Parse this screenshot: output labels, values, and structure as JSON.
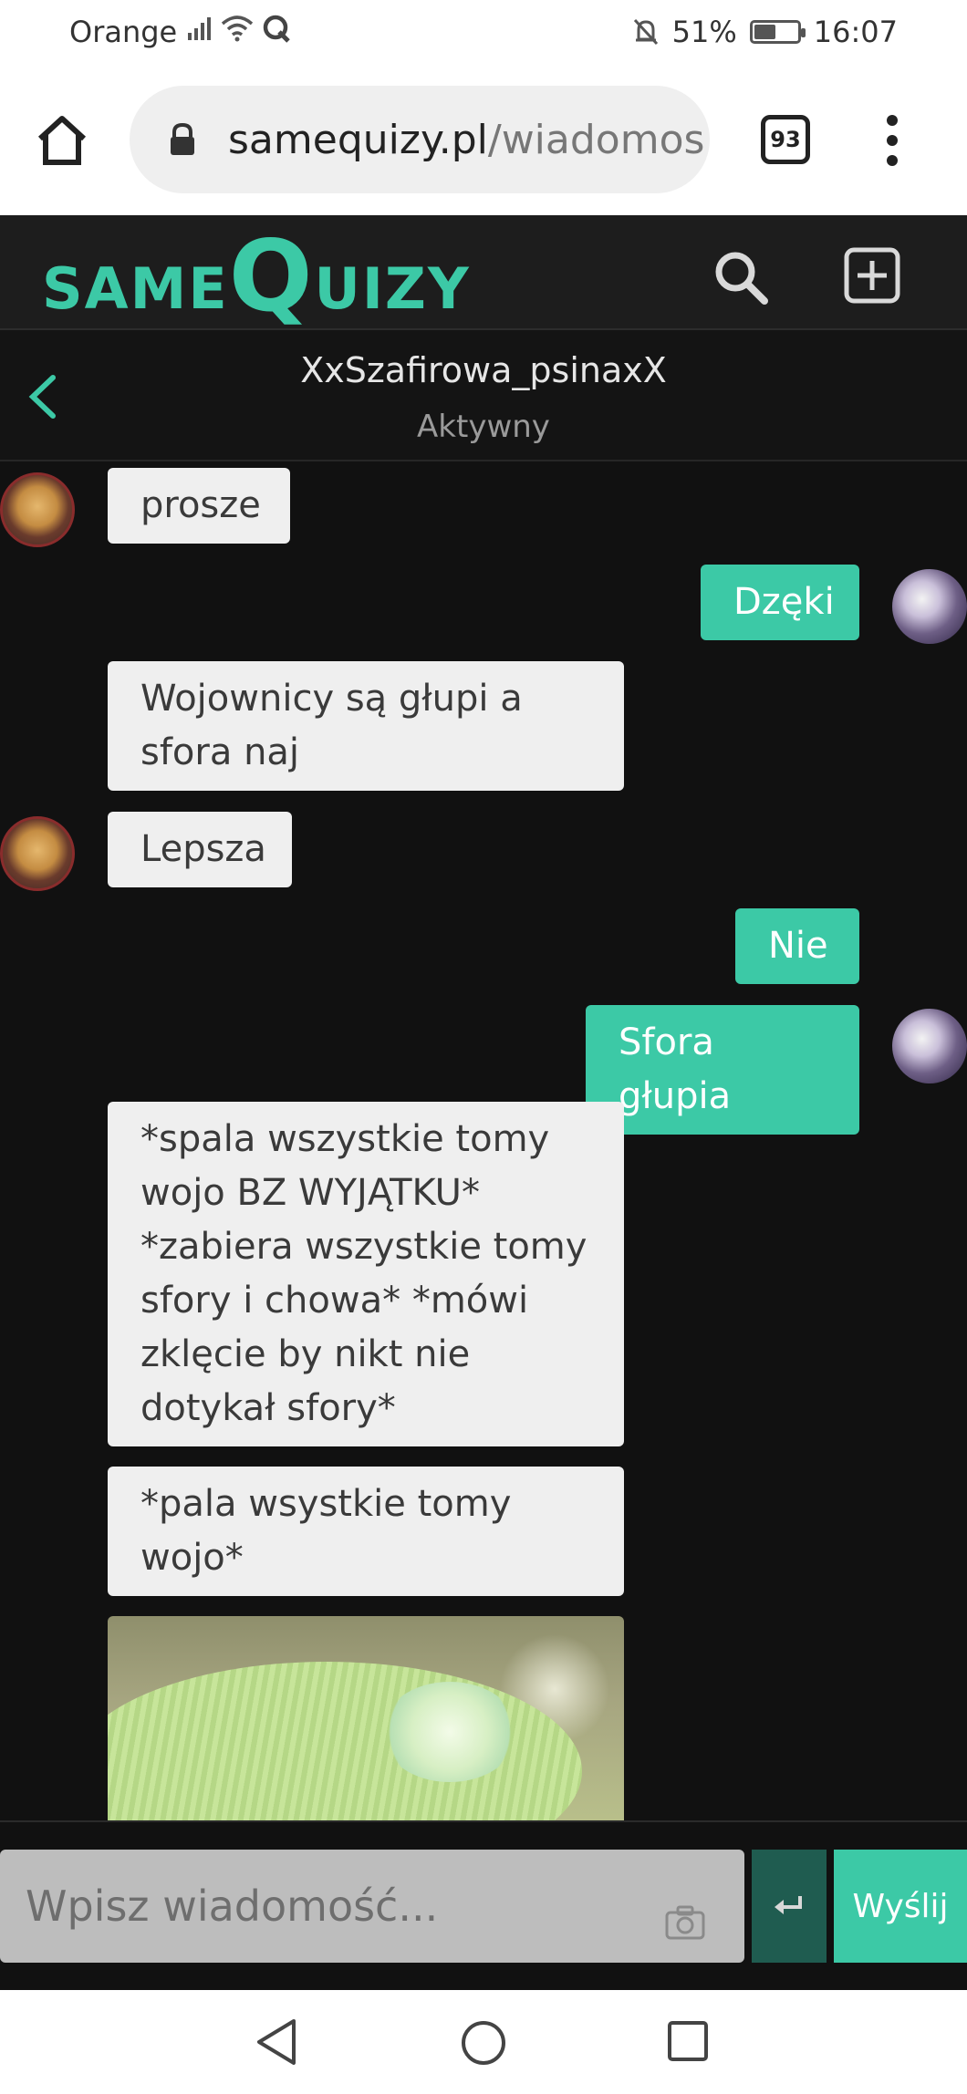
{
  "status_bar": {
    "carrier": "Orange",
    "battery": "51%",
    "battery_level": 0.51,
    "time": "16:07"
  },
  "browser": {
    "url_domain": "samequizy.pl",
    "url_path": "/wiadomos",
    "tab_count": "93"
  },
  "site": {
    "logo_small": "SAME",
    "logo_big": "Q",
    "logo_rest": "UIZY",
    "accent_color": "#3cc9a6"
  },
  "chat": {
    "name": "XxSzafirowa_psinaxX",
    "status": "Aktywny"
  },
  "messages": [
    {
      "side": "in",
      "text": "prosze"
    },
    {
      "side": "out",
      "text": "Dzęki"
    },
    {
      "side": "in",
      "text": "Wojownicy są głupi a sfora naj"
    },
    {
      "side": "in",
      "text": "Lepsza"
    },
    {
      "side": "out",
      "text": "Nie"
    },
    {
      "side": "out",
      "text": "Sfora głupia"
    },
    {
      "side": "in",
      "text": "*spala wszystkie tomy wojo BZ WYJĄTKU* *zabiera wszystkie tomy sfory i chowa* *mówi zklęcie by nikt nie dotykał sfory*"
    },
    {
      "side": "in",
      "text": "*pala wsystkie tomy wojo*"
    }
  ],
  "composer": {
    "placeholder": "Wpisz wiadomość...",
    "send_label": "Wyślij"
  }
}
